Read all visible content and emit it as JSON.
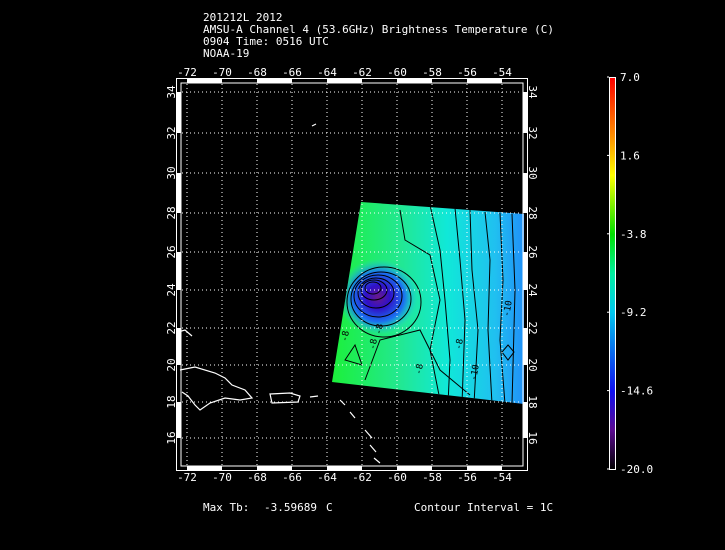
{
  "header": {
    "line1": "201212L 2012",
    "line2": "AMSU-A Channel 4 (53.6GHz) Brightness Temperature (C)",
    "line3": "0904 Time: 0516 UTC",
    "line4": "NOAA-19"
  },
  "map": {
    "lon_ticks": [
      "-72",
      "-70",
      "-68",
      "-66",
      "-64",
      "-62",
      "-60",
      "-58",
      "-56",
      "-54"
    ],
    "lon_values": [
      -72,
      -70,
      -68,
      -66,
      -64,
      -62,
      -60,
      -58,
      -56,
      -54
    ],
    "lat_ticks": [
      "16",
      "18",
      "20",
      "22",
      "24",
      "26",
      "28",
      "30",
      "32",
      "34"
    ],
    "lat_values": [
      16,
      18,
      20,
      22,
      24,
      26,
      28,
      30,
      32,
      34
    ],
    "contour_labels": [
      "-8",
      "-8",
      "-8",
      "-8",
      "-8",
      "-10",
      "-10"
    ],
    "center_lon": -61.4,
    "center_lat": 24.3
  },
  "colorbar": {
    "labels": [
      "7.0",
      "1.6",
      "-3.8",
      "-9.2",
      "-14.6",
      "-20.0"
    ],
    "min": -20.0,
    "max": 7.0
  },
  "footer": {
    "max_tb_label": "Max Tb:",
    "max_tb_value": "-3.59689",
    "max_tb_unit": "C",
    "contour_interval": "Contour Interval = 1C"
  }
}
